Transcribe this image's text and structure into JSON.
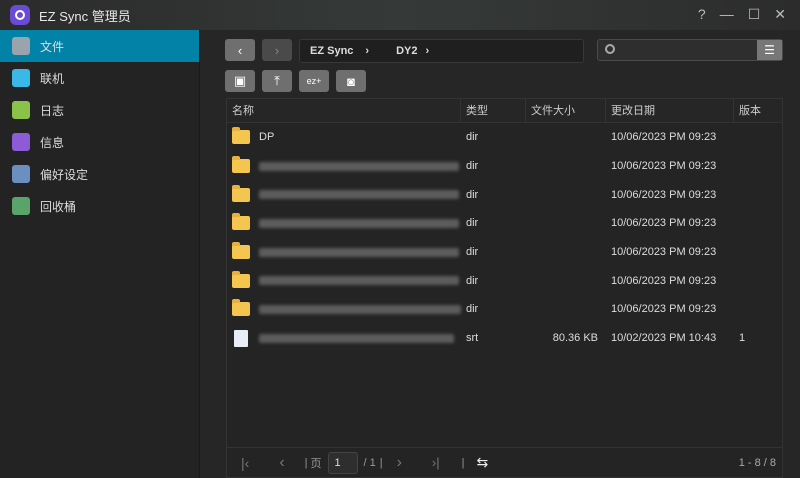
{
  "titlebar": {
    "title": "EZ Sync 管理员",
    "help": "?",
    "minimize": "—",
    "maximize": "☐",
    "close": "✕"
  },
  "sidebar": {
    "items": [
      {
        "label": "文件",
        "color": "#9aa4ad"
      },
      {
        "label": "联机",
        "color": "#3ab8e8"
      },
      {
        "label": "日志",
        "color": "#8bc34a"
      },
      {
        "label": "信息",
        "color": "#8e5bd6"
      },
      {
        "label": "偏好设定",
        "color": "#6b8fbf"
      },
      {
        "label": "回收桶",
        "color": "#5aa36a"
      }
    ]
  },
  "nav": {
    "back": "‹",
    "forward": "›",
    "breadcrumb": [
      "EZ Sync",
      "DY2"
    ],
    "sep": "›"
  },
  "table": {
    "headers": [
      "名称",
      "类型",
      "文件大小",
      "更改日期",
      "版本"
    ],
    "rows": [
      {
        "name": "DP",
        "type": "dir",
        "size": "",
        "date": "10/06/2023 PM 09:23",
        "version": "",
        "kind": "folder"
      },
      {
        "name": "",
        "type": "dir",
        "size": "",
        "date": "10/06/2023 PM 09:23",
        "version": "",
        "kind": "folder"
      },
      {
        "name": "",
        "type": "dir",
        "size": "",
        "date": "10/06/2023 PM 09:23",
        "version": "",
        "kind": "folder"
      },
      {
        "name": "",
        "type": "dir",
        "size": "",
        "date": "10/06/2023 PM 09:23",
        "version": "",
        "kind": "folder"
      },
      {
        "name": "",
        "type": "dir",
        "size": "",
        "date": "10/06/2023 PM 09:23",
        "version": "",
        "kind": "folder"
      },
      {
        "name": "",
        "type": "dir",
        "size": "",
        "date": "10/06/2023 PM 09:23",
        "version": "",
        "kind": "folder"
      },
      {
        "name": "",
        "type": "dir",
        "size": "",
        "date": "10/06/2023 PM 09:23",
        "version": "",
        "kind": "folder"
      },
      {
        "name": "",
        "type": "srt",
        "size": "80.36 KB",
        "date": "10/02/2023 PM 10:43",
        "version": "1",
        "kind": "file"
      }
    ]
  },
  "pager": {
    "page_label": "页",
    "page": "1",
    "total": "/ 1",
    "summary": "1 - 8 / 8"
  }
}
